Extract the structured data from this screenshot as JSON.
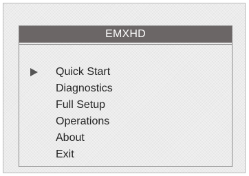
{
  "window": {
    "title": "EMXHD"
  },
  "menu": {
    "selected_index": 0,
    "items": [
      {
        "label": "Quick Start"
      },
      {
        "label": "Diagnostics"
      },
      {
        "label": "Full Setup"
      },
      {
        "label": "Operations"
      },
      {
        "label": "About"
      },
      {
        "label": "Exit"
      }
    ]
  },
  "icons": {
    "cursor": "triangle-right-icon"
  },
  "colors": {
    "title_bar": "#6b6666",
    "title_text": "#ffffff",
    "background": "#ececec",
    "text": "#222222",
    "cursor": "#555555"
  }
}
